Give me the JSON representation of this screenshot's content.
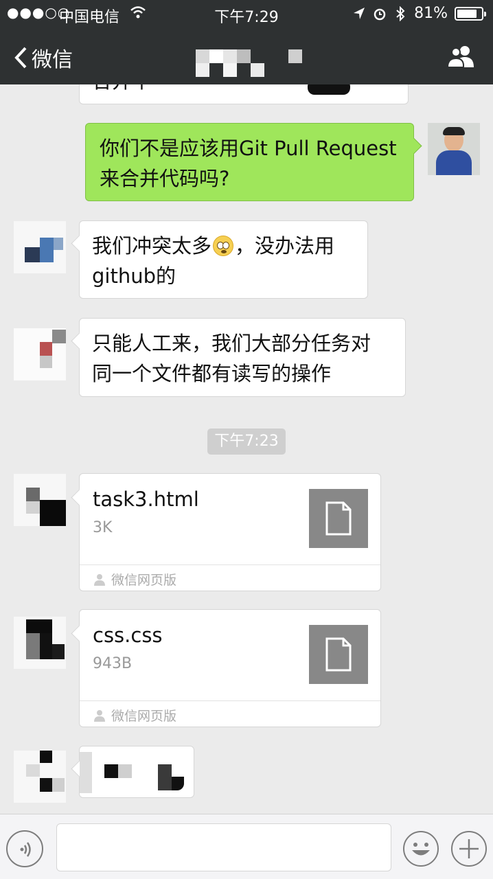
{
  "status_bar": {
    "signal": "●●●○○",
    "carrier": "中国电信",
    "time": "下午7:29",
    "battery_text": "81%",
    "battery_level": 0.81
  },
  "nav": {
    "back_label": "微信",
    "title": ""
  },
  "messages": {
    "partial_top_text": "合并中",
    "m1": {
      "line1": "你们不是应该用Git Pull Request",
      "line2": " 来合并代码吗?"
    },
    "m2": {
      "before_emoji": "我们冲突太多",
      "after_emoji": "，没办法用",
      "line2": "github的"
    },
    "m3": {
      "line1": "只能人工来，我们大部分任务对",
      "line2": "同一个文件都有读写的操作"
    },
    "timestamp": "下午7:23",
    "files": [
      {
        "name": "task3.html",
        "size": "3K",
        "source": "微信网页版"
      },
      {
        "name": "css.css",
        "size": "943B",
        "source": "微信网页版"
      }
    ]
  },
  "input": {
    "placeholder": "",
    "value": ""
  },
  "icons": {
    "back": "chevron-left-icon",
    "group": "group-members-icon",
    "voice": "voice-icon",
    "emoji": "smiley-icon",
    "plus": "plus-icon",
    "file": "document-icon"
  },
  "colors": {
    "nav_bg": "#2e3132",
    "chat_bg": "#ebebeb",
    "my_bubble": "#9fe65b",
    "their_bubble": "#ffffff"
  }
}
